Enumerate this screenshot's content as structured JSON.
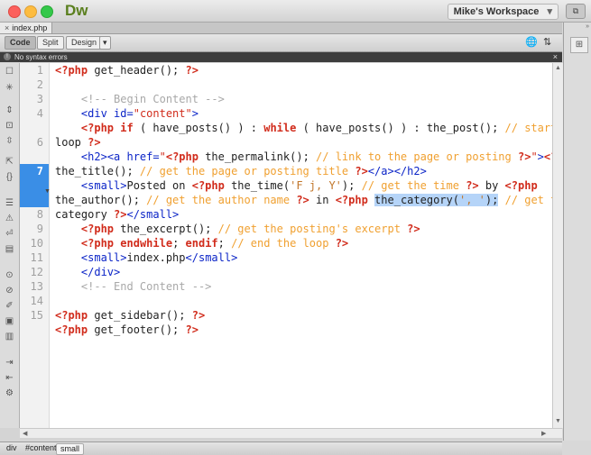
{
  "window": {
    "app_name": "Dw",
    "workspace_label": "Mike's Workspace",
    "workspace_chevron": "▾",
    "ws_icon": "⧉"
  },
  "document": {
    "tab_name": "index.php",
    "tab_close": "×",
    "view_buttons": [
      "Code",
      "Split",
      "Design"
    ],
    "view_dropdown": "▾",
    "active_view": "Code",
    "toolbar_icons": [
      "globe-icon",
      "sort-icon"
    ],
    "toolbar_glyphs": [
      "🌐",
      "⇅"
    ]
  },
  "status": {
    "text": "No syntax errors",
    "icon": "!",
    "close": "×"
  },
  "line_numbers": [
    "1",
    "2",
    "3",
    "4",
    "",
    "6",
    "",
    "7",
    "",
    "",
    "8",
    "9",
    "10",
    "11",
    "12",
    "13",
    "14",
    "15"
  ],
  "code_lines": [
    "<?php get_header(); ?>",
    "",
    "    <!-- Begin Content -->",
    "    <div id=\"content\">",
    "    <?php if ( have_posts() ) : while ( have_posts() ) : the_post(); // start the",
    "loop ?>",
    "    <h2><a href=\"<?php the_permalink(); // link to the page or posting ?>\"><?php",
    "the_title(); // get the page or posting title ?></a></h2>",
    "    <small>Posted on <?php the_time('F j, Y'); // get the time ?> by <?php",
    "the_author(); // get the author name ?> in <?php the_category(', '); // get the",
    "category ?></small>",
    "    <?php the_excerpt(); // get the posting's excerpt ?>",
    "    <?php endwhile; endif; // end the loop ?>",
    "    <small>index.php</small>",
    "    </div>",
    "    <!-- End Content -->",
    "",
    "<?php get_sidebar(); ?>",
    "<?php get_footer(); ?>"
  ],
  "selection": "the_category(', ');",
  "tag_selector": [
    "div",
    "#content",
    "small"
  ],
  "colors": {
    "php_keyword": "#d12c1c",
    "php_comment": "#f0a030",
    "php_string": "#c1762a",
    "html_tag": "#0b24c7",
    "html_comment": "#a8a8a8",
    "selection": "#b5d4f8",
    "current_line": "#3a8ee6"
  }
}
